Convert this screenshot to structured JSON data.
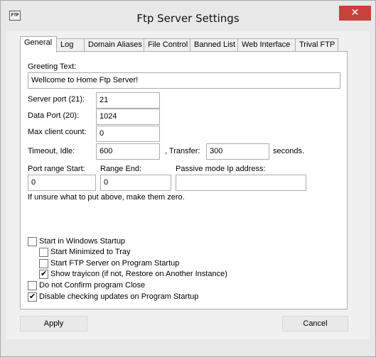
{
  "window": {
    "title": "Ftp Server Settings",
    "icon_text": "FTP",
    "close_glyph": "✕"
  },
  "tabs": [
    {
      "label": "General",
      "active": true
    },
    {
      "label": "Log"
    },
    {
      "label": "Domain Aliases"
    },
    {
      "label": "File Control"
    },
    {
      "label": "Banned List"
    },
    {
      "label": "Web Interface"
    },
    {
      "label": "Trival FTP"
    }
  ],
  "general": {
    "greeting_label": "Greeting Text:",
    "greeting_value": "Wellcome to Home Ftp Server!",
    "server_port_label": "Server port (21):",
    "server_port_value": "21",
    "data_port_label": "Data Port (20):",
    "data_port_value": "1024",
    "max_client_label": "Max client count:",
    "max_client_value": "0",
    "timeout_label": "Timeout, Idle:",
    "timeout_idle_value": "600",
    "transfer_label": ", Transfer:",
    "transfer_value": "300",
    "seconds_label": "seconds.",
    "port_range_start_label": "Port range Start:",
    "port_range_start_value": "0",
    "range_end_label": "Range End:",
    "range_end_value": "0",
    "passive_ip_label": "Passive mode Ip address:",
    "passive_ip_value": "",
    "hint": "If unsure what to put above, make them zero."
  },
  "options": [
    {
      "label": "Start in Windows Startup",
      "checked": false
    },
    {
      "label": "Start Minimized to Tray",
      "checked": false
    },
    {
      "label": "Start FTP Server on Program Startup",
      "checked": false
    },
    {
      "label": "Show trayicon (if not, Restore on Another Instance)",
      "checked": true
    },
    {
      "label": "Do not Confirm program Close",
      "checked": false
    },
    {
      "label": "Disable checking updates on Program Startup",
      "checked": true
    }
  ],
  "buttons": {
    "apply": "Apply",
    "cancel": "Cancel"
  }
}
